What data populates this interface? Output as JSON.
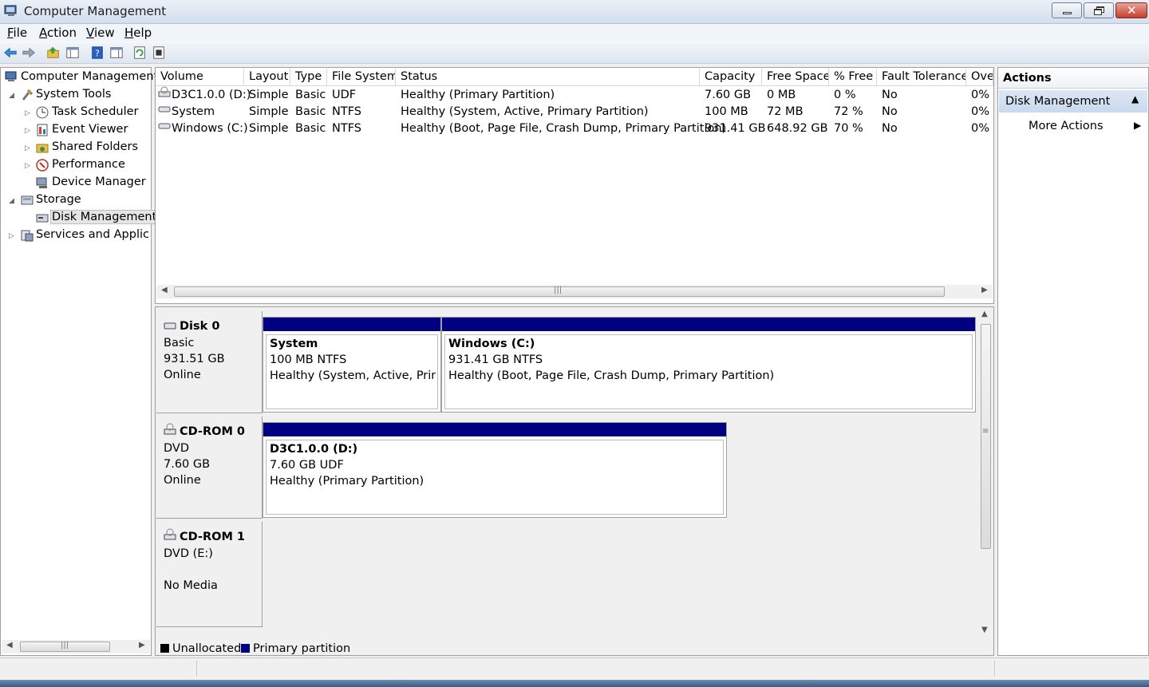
{
  "window": {
    "title": "Computer Management"
  },
  "menu": [
    "File",
    "Action",
    "View",
    "Help"
  ],
  "toolbar": [
    "back-icon",
    "forward-icon",
    "up-icon",
    "show-hide-tree-icon",
    "help-icon",
    "properties-icon",
    "refresh-icon",
    "export-icon"
  ],
  "tree": {
    "root": "Computer Management",
    "system_tools": "System Tools",
    "task_scheduler": "Task Scheduler",
    "event_viewer": "Event Viewer",
    "shared_folders": "Shared Folders",
    "performance": "Performance",
    "device_manager": "Device Manager",
    "storage": "Storage",
    "disk_management": "Disk Management",
    "services": "Services and Applications"
  },
  "volumes": {
    "columns": [
      "Volume",
      "Layout",
      "Type",
      "File System",
      "Status",
      "Capacity",
      "Free Space",
      "% Free",
      "Fault Tolerance",
      "Ove"
    ],
    "rows": [
      [
        "D3C1.0.0 (D:)",
        "Simple",
        "Basic",
        "UDF",
        "Healthy (Primary Partition)",
        "7.60 GB",
        "0 MB",
        "0 %",
        "No",
        "0%"
      ],
      [
        "System",
        "Simple",
        "Basic",
        "NTFS",
        "Healthy (System, Active, Primary Partition)",
        "100 MB",
        "72 MB",
        "72 %",
        "No",
        "0%"
      ],
      [
        "Windows (C:)",
        "Simple",
        "Basic",
        "NTFS",
        "Healthy (Boot, Page File, Crash Dump, Primary Partition)",
        "931.41 GB",
        "648.92 GB",
        "70 %",
        "No",
        "0%"
      ]
    ]
  },
  "disks": [
    {
      "name": "Disk 0",
      "type": "Basic",
      "size": "931.51 GB",
      "state": "Online",
      "partitions": [
        {
          "name": "System",
          "size": "100 MB NTFS",
          "status": "Healthy (System, Active, Primar"
        },
        {
          "name": "Windows  (C:)",
          "size": "931.41 GB NTFS",
          "status": "Healthy (Boot, Page File, Crash Dump, Primary Partition)"
        }
      ]
    },
    {
      "name": "CD-ROM 0",
      "type": "DVD",
      "size": "7.60 GB",
      "state": "Online",
      "partitions": [
        {
          "name": "D3C1.0.0  (D:)",
          "size": "7.60 GB UDF",
          "status": "Healthy (Primary Partition)"
        }
      ]
    },
    {
      "name": "CD-ROM 1",
      "type": "DVD (E:)",
      "size": "",
      "state": "No Media",
      "partitions": []
    }
  ],
  "legend": [
    {
      "label": "Unallocated",
      "color": "#000000"
    },
    {
      "label": "Primary partition",
      "color": "#000080"
    }
  ],
  "actions": {
    "header": "Actions",
    "section": "Disk Management",
    "more": "More Actions"
  },
  "colors": {
    "partition_bar": "#000080",
    "titlebar": "#dbe4f0",
    "close_button": "#c6402c"
  }
}
